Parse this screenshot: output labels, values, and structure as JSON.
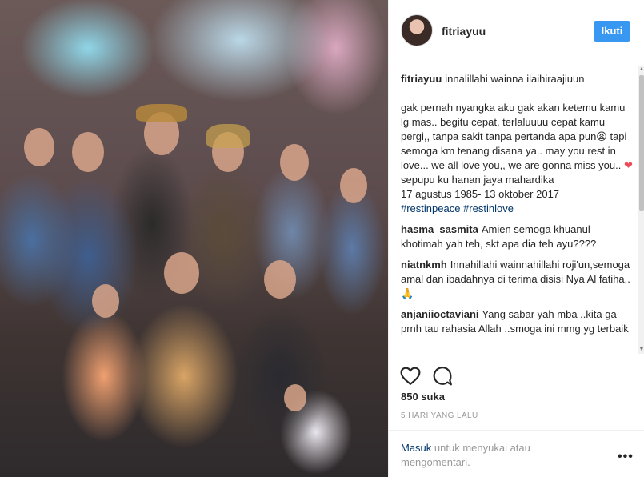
{
  "header": {
    "username": "fitriayuu",
    "follow_label": "Ikuti"
  },
  "caption": {
    "username": "fitriayuu",
    "line1": "innalillahi wainna ilaihiraajiuun",
    "body": "gak pernah nyangka aku gak akan ketemu kamu lg mas.. begitu cepat, terlaluuuu cepat kamu pergi,, tanpa sakit tanpa pertanda apa pun😫 tapi semoga km tenang disana ya.. may you rest in love... we all love you,, we are gonna miss you..",
    "heart": "❤",
    "line_cousin": "sepupu ku hanan jaya mahardika",
    "line_dates": "17 agustus 1985- 13 oktober 2017",
    "hashtags": "#restinpeace #restinlove"
  },
  "comments": [
    {
      "user": "hasma_sasmita",
      "text": "Amien semoga khuanul khotimah yah teh, skt apa dia teh ayu????"
    },
    {
      "user": "niatnkmh",
      "text": "Innahillahi wainnahillahi roji'un,semoga amal dan ibadahnya di terima disisi Nya Al fatiha..🙏"
    },
    {
      "user": "anjaniioctaviani",
      "text": "Yang sabar yah mba ..kita ga prnh tau rahasia Allah ..smoga ini mmg yg terbaik"
    }
  ],
  "likes": "850 suka",
  "time": "5 HARI YANG LALU",
  "login": {
    "link": "Masuk",
    "text": " untuk menyukai atau mengomentari."
  },
  "more": "•••",
  "colors": {
    "accent": "#3897f0",
    "link": "#003569",
    "muted": "#999999",
    "heart": "#ed4956"
  },
  "icons": [
    "heart-outline-icon",
    "comment-bubble-icon",
    "more-options-icon",
    "scroll-up-arrow-icon",
    "scroll-down-arrow-icon"
  ]
}
